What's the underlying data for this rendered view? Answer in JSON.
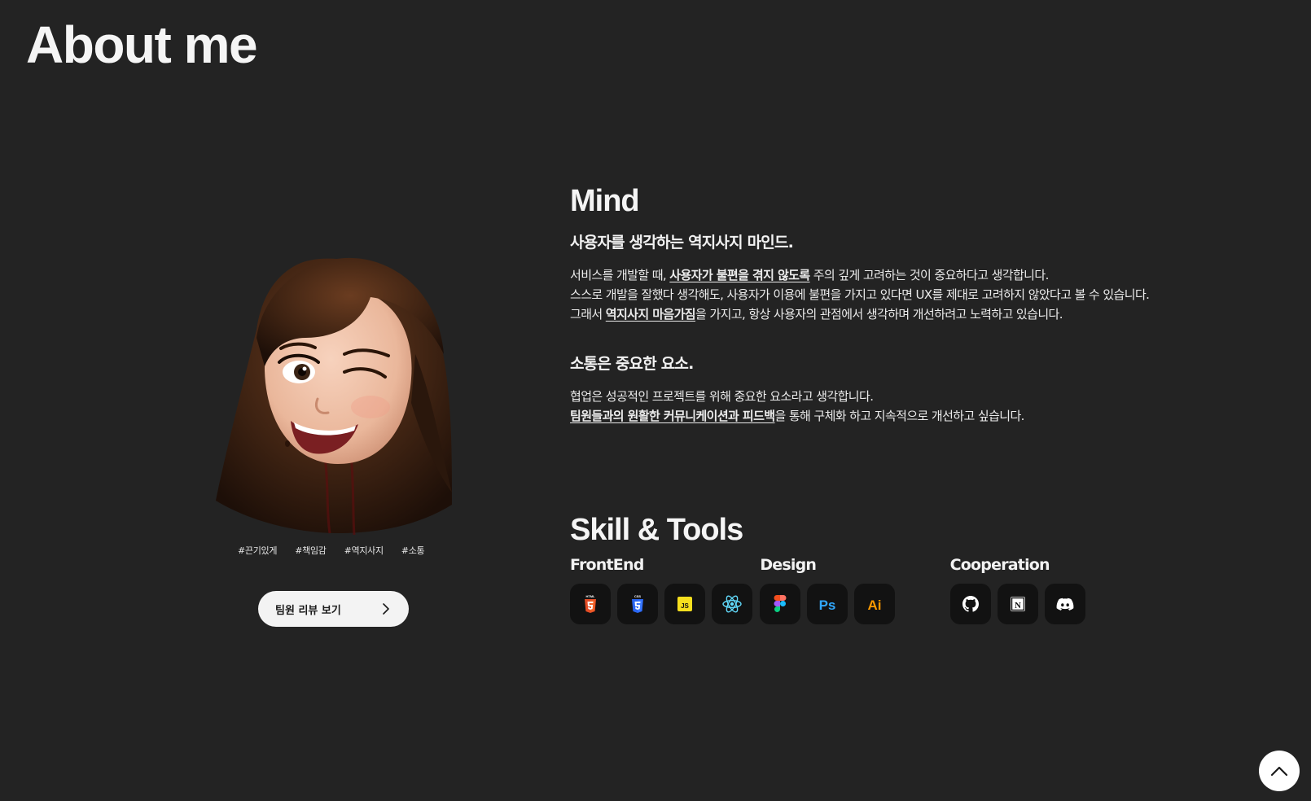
{
  "page": {
    "title": "About me"
  },
  "profile": {
    "avatar_icon": "memoji-avatar",
    "hashtags": [
      "#끈기있게",
      "#책임감",
      "#역지사지",
      "#소통"
    ],
    "review_button_label": "팀원 리뷰 보기",
    "review_button_icon": "chevron-right-icon"
  },
  "mind": {
    "heading": "Mind",
    "subheading1": "사용자를 생각하는 역지사지 마인드.",
    "p1_line1_pre": "서비스를 개발할 때, ",
    "p1_line1_em": "사용자가 불편을 겪지 않도록",
    "p1_line1_post": " 주의 깊게 고려하는 것이 중요하다고 생각합니다.",
    "p1_line2": "스스로 개발을 잘했다 생각해도, 사용자가 이용에 불편을 가지고 있다면 UX를 제대로 고려하지 않았다고 볼 수 있습니다.",
    "p1_line3_pre": "그래서 ",
    "p1_line3_em": "역지사지 마음가짐",
    "p1_line3_post": "을 가지고, 항상 사용자의 관점에서 생각하며 개선하려고 노력하고 있습니다.",
    "subheading2": "소통은 중요한 요소.",
    "p2_line1": "협업은 성공적인 프로젝트를 위해 중요한 요소라고 생각합니다.",
    "p2_line2_em": "팀원들과의 원활한 커뮤니케이션과 피드백",
    "p2_line2_post": "을 통해 구체화 하고 지속적으로 개선하고 싶습니다."
  },
  "skills": {
    "heading": "Skill & Tools",
    "groups": [
      {
        "title": "FrontEnd",
        "icons": [
          "html5-icon",
          "css3-icon",
          "javascript-icon",
          "react-icon"
        ]
      },
      {
        "title": "Design",
        "icons": [
          "figma-icon",
          "photoshop-icon",
          "illustrator-icon"
        ]
      },
      {
        "title": "Cooperation",
        "icons": [
          "github-icon",
          "notion-icon",
          "discord-icon"
        ]
      }
    ],
    "icon_text": {
      "html": "HTML",
      "css": "CSS",
      "js": "JS",
      "ps": "Ps",
      "ai": "Ai",
      "notion": "N"
    },
    "colors": {
      "html": "#e44d26",
      "css": "#2965f1",
      "js": "#f7df1e",
      "react": "#61dafb",
      "ps": "#31a8ff",
      "ai": "#ff9a00",
      "tile_bg": "#121212"
    }
  },
  "scroll_top": {
    "icon": "arrow-up-icon"
  },
  "theme": {
    "background": "#232323",
    "text": "#f2f2f2"
  }
}
